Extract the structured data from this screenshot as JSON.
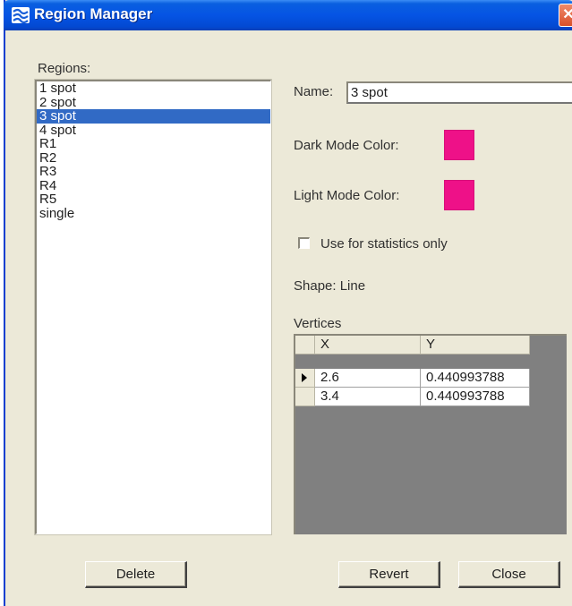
{
  "window": {
    "title": "Region Manager",
    "close_glyph": "✕"
  },
  "regions": {
    "label": "Regions:",
    "items": [
      "1 spot",
      "2 spot",
      "3 spot",
      "4 spot",
      "R1",
      "R2",
      "R3",
      "R4",
      "R5",
      "single"
    ],
    "selected": "3 spot"
  },
  "details": {
    "name_label": "Name:",
    "name_value": "3 spot",
    "dark_label": "Dark Mode Color:",
    "dark_color": "#ee1188",
    "light_label": "Light Mode Color:",
    "light_color": "#ee1188",
    "stats_label": "Use for statistics only",
    "stats_checked": false,
    "shape_text": "Shape: Line",
    "vertices_label": "Vertices",
    "vertices": {
      "columns": [
        "X",
        "Y"
      ],
      "rows": [
        {
          "x": "2.6",
          "y": "0.440993788",
          "current": true
        },
        {
          "x": "3.4",
          "y": "0.440993788",
          "current": false
        }
      ]
    }
  },
  "buttons": {
    "delete": "Delete",
    "revert": "Revert",
    "close": "Close"
  },
  "icons": {
    "app": "app-icon",
    "close": "close-icon",
    "row_pointer": "row-pointer-icon"
  }
}
